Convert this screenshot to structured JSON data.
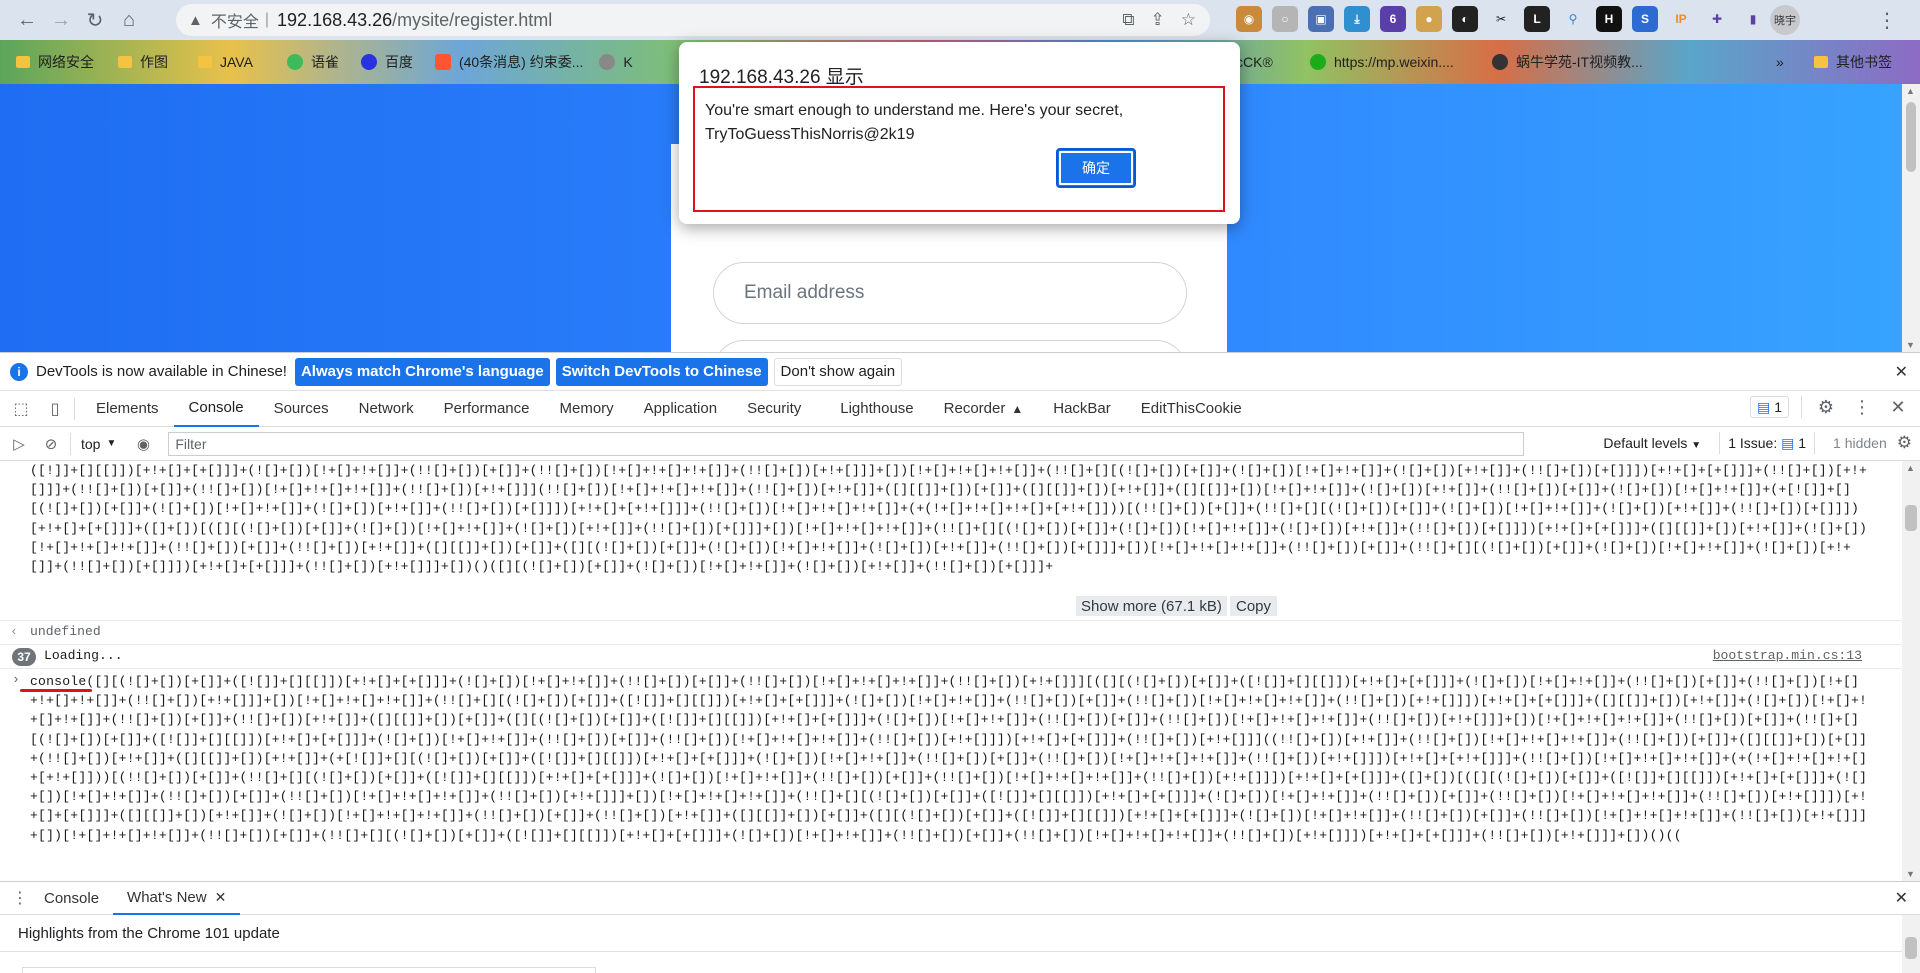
{
  "browser": {
    "insecure_label": "不安全",
    "url_host": "192.168.43.26",
    "url_path": "/mysite/register.html",
    "profile_label": "晓宇"
  },
  "bookmarks": [
    {
      "label": "网络安全",
      "icon": "folder-icon",
      "color": "#f5c241"
    },
    {
      "label": "作图",
      "icon": "folder-icon",
      "color": "#f5c241"
    },
    {
      "label": "JAVA",
      "icon": "folder-icon",
      "color": "#f5c241"
    },
    {
      "label": "语雀",
      "icon": "yuque-icon",
      "color": "#3dbb5c"
    },
    {
      "label": "百度",
      "icon": "baidu-icon",
      "color": "#2932e1"
    },
    {
      "label": "(40条消息) 约束委...",
      "icon": "csdn-icon",
      "color": "#fc5531"
    },
    {
      "label": "K",
      "icon": "site-icon",
      "color": "#888888"
    }
  ],
  "bookmarks_right": [
    {
      "label": "cCK®",
      "icon": "site-icon",
      "color": "#555555"
    },
    {
      "label": "https://mp.weixin....",
      "icon": "wechat-icon",
      "color": "#1aad19"
    },
    {
      "label": "蜗牛学苑-IT视频教...",
      "icon": "site-icon",
      "color": "#333333"
    }
  ],
  "bookmarks_more": "»",
  "bookmarks_other": "其他书签",
  "page": {
    "email_placeholder": "Email address"
  },
  "alert": {
    "title": "192.168.43.26 显示",
    "message": "You're smart enough to understand me. Here's your secret, TryToGuessThisNorris@2k19",
    "ok_label": "确定"
  },
  "devtools": {
    "infobar": {
      "message": "DevTools is now available in Chinese!",
      "btn_match": "Always match Chrome's language",
      "btn_switch": "Switch DevTools to Chinese",
      "btn_dismiss": "Don't show again"
    },
    "tabs": [
      "Elements",
      "Console",
      "Sources",
      "Network",
      "Performance",
      "Memory",
      "Application",
      "Security",
      "Lighthouse",
      "Recorder",
      "HackBar",
      "EditThisCookie"
    ],
    "active_tab": "Console",
    "issues_badge": "1",
    "console_toolbar": {
      "context": "top",
      "filter_placeholder": "Filter",
      "levels": "Default levels",
      "issues": "1 Issue:",
      "issues_count": "1",
      "hidden": "1 hidden"
    },
    "console": {
      "block1_text": "([!]]+[][[]])[+!+[]+[+[]]]+(![]+[])[!+[]+!+[]]+(!![]+[])[+[]]+(!![]+[])[!+[]+!+[]+!+[]]+(!![]+[])[+!+[]]]+[])[!+[]+!+[]+!+[]]+(!![]+[][(![]+[])[+[]]+(![]+[])[!+[]+!+[]]+(![]+[])[+!+[]]+(!![]+[])[+[]]])[+!+[]+[+[]]]+(!![]+[])[+!+[]]]+(!![]+[])[+[]]+(!![]+[])[!+[]+!+[]+!+[]]+(!![]+[])[+!+[]]](!![]+[])[!+[]+!+[]+!+[]]+(!![]+[])[+!+[]]+([][[]]+[])[+[]]+([][[]]+[])[+!+[]]+([][[]]+[])[!+[]+!+[]]+(![]+[])[+!+[]]+(!![]+[])[+[]]+(![]+[])[!+[]+!+[]]+(+[![]]+[][(![]+[])[+[]]+(![]+[])[!+[]+!+[]]+(![]+[])[+!+[]]+(!![]+[])[+[]]])[+!+[]+[+!+[]]]+(!![]+[])[!+[]+!+[]+!+[]]+(+(!+[]+!+[]+!+[]+[+!+[]]))[(!![]+[])[+[]]+(!![]+[][(![]+[])[+[]]+(![]+[])[!+[]+!+[]]+(![]+[])[+!+[]]+(!![]+[])[+[]]])[+!+[]+[+[]]]+([]+[])[([][(![]+[])[+[]]+(![]+[])[!+[]+!+[]]+(![]+[])[+!+[]]+(!![]+[])[+[]]]+[])[!+[]+!+[]+!+[]]+(!![]+[][(![]+[])[+[]]+(![]+[])[!+[]+!+[]]+(![]+[])[+!+[]]+(!![]+[])[+[]]])[+!+[]+[+[]]]+([][[]]+[])[+!+[]]+(![]+[])[!+[]+!+[]+!+[]]+(!![]+[])[+[]]+(!![]+[])[+!+[]]+([][[]]+[])[+[]]+([][(![]+[])[+[]]+(![]+[])[!+[]+!+[]]+(![]+[])[+!+[]]+(!![]+[])[+[]]]+[])[!+[]+!+[]+!+[]]+(!![]+[])[+[]]+(!![]+[][(![]+[])[+[]]+(![]+[])[!+[]+!+[]]+(![]+[])[+!+[]]+(!![]+[])[+[]]])[+!+[]+[+[]]]+(!![]+[])[+!+[]]]+[])()([][(![]+[])[+[]]+(![]+[])[!+[]+!+[]]+(![]+[])[+!+[]]+(!![]+[])[+[]]]+",
      "show_more": "Show more (67.1 kB)",
      "copy": "Copy",
      "undefined_text": "undefined",
      "loading_count": "37",
      "loading_text": "Loading...",
      "loading_source": "bootstrap.min.cs:13",
      "block2_text": "console([][(![]+[])[+[]]+([![]]+[][[]])[+!+[]+[+[]]]+(![]+[])[!+[]+!+[]]+(!![]+[])[+[]]+(!![]+[])[!+[]+!+[]+!+[]]+(!![]+[])[+!+[]]][([][(![]+[])[+[]]+([![]]+[][[]])[+!+[]+[+[]]]+(![]+[])[!+[]+!+[]]+(!![]+[])[+[]]+(!![]+[])[!+[]+!+[]+!+[]]+(!![]+[])[+!+[]]]+[])[!+[]+!+[]+!+[]]+(!![]+[][(![]+[])[+[]]+([![]]+[][[]])[+!+[]+[+[]]]+(![]+[])[!+[]+!+[]]+(!![]+[])[+[]]+(!![]+[])[!+[]+!+[]+!+[]]+(!![]+[])[+!+[]]])[+!+[]+[+[]]]+([][[]]+[])[+!+[]]+(![]+[])[!+[]+!+[]+!+[]]+(!![]+[])[+[]]+(!![]+[])[+!+[]]+([][[]]+[])[+[]]+([][(![]+[])[+[]]+([![]]+[][[]])[+!+[]+[+[]]]+(![]+[])[!+[]+!+[]]+(!![]+[])[+[]]+(!![]+[])[!+[]+!+[]+!+[]]+(!![]+[])[+!+[]]]+[])[!+[]+!+[]+!+[]]+(!![]+[])[+[]]+(!![]+[][(![]+[])[+[]]+([![]]+[][[]])[+!+[]+[+[]]]+(![]+[])[!+[]+!+[]]+(!![]+[])[+[]]+(!![]+[])[!+[]+!+[]+!+[]]+(!![]+[])[+!+[]]])[+!+[]+[+[]]]+(!![]+[])[+!+[]]]((!![]+[])[+!+[]]+(!![]+[])[!+[]+!+[]+!+[]]+(!![]+[])[+[]]+([][[]]+[])[+[]]+(!![]+[])[+!+[]]+([][[]]+[])[+!+[]]+(+[![]]+[][(![]+[])[+[]]+([![]]+[][[]])[+!+[]+[+[]]]+(![]+[])[!+[]+!+[]]+(!![]+[])[+[]]+(!![]+[])[!+[]+!+[]+!+[]]+(!![]+[])[+!+[]]])[+!+[]+[+!+[]]]+(!![]+[])[!+[]+!+[]+!+[]]+(+(!+[]+!+[]+!+[]+[+!+[]]))[(!![]+[])[+[]]+(!![]+[][(![]+[])[+[]]+([![]]+[][[]])[+!+[]+[+[]]]+(![]+[])[!+[]+!+[]]+(!![]+[])[+[]]+(!![]+[])[!+[]+!+[]+!+[]]+(!![]+[])[+!+[]]])[+!+[]+[+[]]]+([]+[])[([][(![]+[])[+[]]+([![]]+[][[]])[+!+[]+[+[]]]+(![]+[])[!+[]+!+[]]+(!![]+[])[+[]]+(!![]+[])[!+[]+!+[]+!+[]]+(!![]+[])[+!+[]]]+[])[!+[]+!+[]+!+[]]+(!![]+[][(![]+[])[+[]]+([![]]+[][[]])[+!+[]+[+[]]]+(![]+[])[!+[]+!+[]]+(!![]+[])[+[]]+(!![]+[])[!+[]+!+[]+!+[]]+(!![]+[])[+!+[]]])[+!+[]+[+[]]]+([][[]]+[])[+!+[]]+(![]+[])[!+[]+!+[]+!+[]]+(!![]+[])[+[]]+(!![]+[])[+!+[]]+([][[]]+[])[+[]]+([][(![]+[])[+[]]+([![]]+[][[]])[+!+[]+[+[]]]+(![]+[])[!+[]+!+[]]+(!![]+[])[+[]]+(!![]+[])[!+[]+!+[]+!+[]]+(!![]+[])[+!+[]]]+[])[!+[]+!+[]+!+[]]+(!![]+[])[+[]]+(!![]+[][(![]+[])[+[]]+([![]]+[][[]])[+!+[]+[+[]]]+(![]+[])[!+[]+!+[]]+(!![]+[])[+[]]+(!![]+[])[!+[]+!+[]+!+[]]+(!![]+[])[+!+[]]])[+!+[]+[+[]]]+(!![]+[])[+!+[]]]+[])()(("
    },
    "drawer": {
      "tabs": [
        "Console",
        "What's New"
      ],
      "active": "What's New",
      "whats_new_text": "Highlights from the Chrome 101 update"
    }
  }
}
